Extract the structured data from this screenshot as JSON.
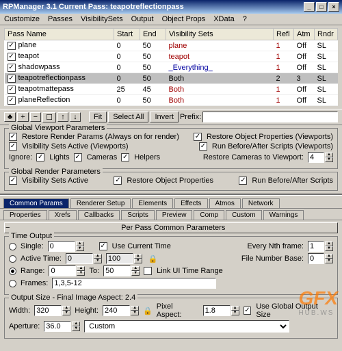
{
  "window": {
    "title": "RPManager 3.1   Current Pass: teapotreflectionpass"
  },
  "menus": [
    "Customize",
    "Passes",
    "VisibilitySets",
    "Output",
    "Object Props",
    "XData",
    "?"
  ],
  "table": {
    "headers": [
      "Pass Name",
      "Start",
      "End",
      "Visibility Sets",
      "Refl",
      "Atm",
      "Rndr"
    ],
    "rows": [
      {
        "on": true,
        "name": "plane",
        "start": 0,
        "end": 50,
        "vis": "plane",
        "visClass": "red",
        "refl": 1,
        "atm": "Off",
        "rndr": "SL"
      },
      {
        "on": true,
        "name": "teapot",
        "start": 0,
        "end": 50,
        "vis": "teapot",
        "visClass": "red",
        "refl": 1,
        "atm": "Off",
        "rndr": "SL"
      },
      {
        "on": true,
        "name": "shadowpass",
        "start": 0,
        "end": 50,
        "vis": "_Everything_",
        "visClass": "blue",
        "refl": 1,
        "atm": "Off",
        "rndr": "SL"
      },
      {
        "on": true,
        "name": "teapotreflectionpass",
        "start": 0,
        "end": 50,
        "vis": "Both",
        "visClass": "",
        "refl": 2,
        "atm": 3,
        "rndr": "SL",
        "sel": true
      },
      {
        "on": true,
        "name": "teapotmattepass",
        "start": 25,
        "end": 45,
        "vis": "Both",
        "visClass": "red",
        "refl": 1,
        "atm": "Off",
        "rndr": "SL"
      },
      {
        "on": true,
        "name": "planeReflection",
        "start": 0,
        "end": 50,
        "vis": "Both",
        "visClass": "red",
        "refl": 1,
        "atm": "Off",
        "rndr": "SL"
      }
    ]
  },
  "toolbar": {
    "btns": [
      "♣",
      "+",
      "−",
      "☐",
      "↑",
      "↓"
    ],
    "fit": "Fit",
    "selectAll": "Select All",
    "invert": "Invert",
    "prefix_label": "Prefix:",
    "prefix_val": ""
  },
  "gvp": {
    "title": "Global Viewport Parameters",
    "restoreRender": {
      "on": true,
      "label": "Restore Render Params (Always on for render)"
    },
    "restoreObj": {
      "on": true,
      "label": "Restore Object Properties (Viewports)"
    },
    "visActive": {
      "on": true,
      "label": "Visibility Sets Active (Viewports)"
    },
    "runScripts": {
      "on": true,
      "label": "Run Before/After Scripts (Viewports)"
    },
    "ignore_label": "Ignore:",
    "lights": {
      "on": true,
      "label": "Lights"
    },
    "cameras": {
      "on": true,
      "label": "Cameras"
    },
    "helpers": {
      "on": true,
      "label": "Helpers"
    },
    "restoreCam_label": "Restore Cameras to Viewport:",
    "restoreCam_val": "4"
  },
  "grp": {
    "title": "Global Render Parameters",
    "visActive": {
      "on": true,
      "label": "Visibility Sets Active"
    },
    "restoreObj": {
      "on": true,
      "label": "Restore Object Properties"
    },
    "runScripts": {
      "on": true,
      "label": "Run Before/After Scripts"
    }
  },
  "tabs1": [
    "Common Params",
    "Renderer Setup",
    "Elements",
    "Effects",
    "Atmos",
    "Network"
  ],
  "tabs2": [
    "Properties",
    "Xrefs",
    "Callbacks",
    "Scripts",
    "Preview",
    "Comp",
    "Custom",
    "Warnings"
  ],
  "tabs_active": "Common Params",
  "section_hdr": "Per Pass Common Parameters",
  "timeout": {
    "title": "Time Output",
    "single": {
      "on": false,
      "label": "Single:",
      "val": "0"
    },
    "useCurrent": {
      "on": true,
      "label": "Use Current Time"
    },
    "everyNth_label": "Every Nth frame:",
    "everyNth_val": "1",
    "active": {
      "on": false,
      "label": "Active Time:",
      "from": "0",
      "to": "100"
    },
    "fileNum_label": "File Number Base:",
    "fileNum_val": "0",
    "range": {
      "on": true,
      "label": "Range:",
      "from": "0",
      "to_label": "To:",
      "to": "50"
    },
    "linkUI": {
      "on": false,
      "label": "Link UI Time Range"
    },
    "frames": {
      "on": false,
      "label": "Frames:",
      "val": "1,3,5-12"
    }
  },
  "outsize": {
    "title": "Output Size - Final Image Aspect: 2.4",
    "width_label": "Width:",
    "width_val": "320",
    "height_label": "Height:",
    "height_val": "240",
    "lock_icon": "lock-icon",
    "pixel_label": "Pixel Aspect:",
    "pixel_val": "1.8",
    "useGlobal": {
      "on": true,
      "label": "Use Global Output Size"
    },
    "aperture_label": "Aperture:",
    "aperture_val": "36.0",
    "preset": "Custom"
  },
  "watermark": {
    "big": "GFX",
    "sub": "HUB.WS"
  }
}
